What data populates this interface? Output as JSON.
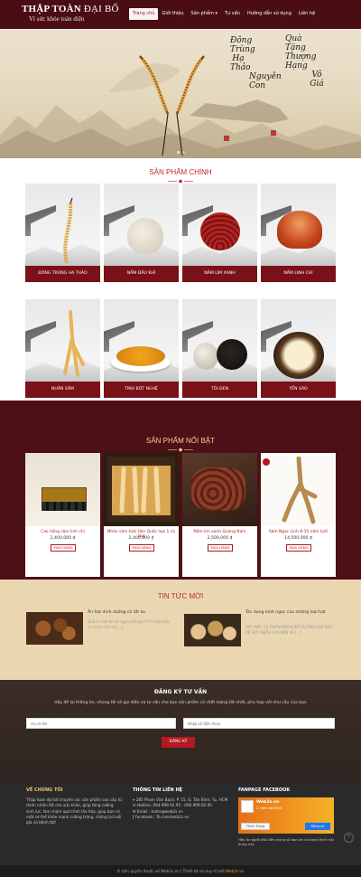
{
  "header": {
    "logo_main": "THẬP TOÀN",
    "logo_accent": " ĐẠI BỔ",
    "tagline": "Vì sức khỏe toàn diện",
    "nav": [
      "Trang chủ",
      "Giới thiệu",
      "Sản phẩm ▾",
      "Tư vấn",
      "Hướng dẫn sử dụng",
      "Liên hệ"
    ]
  },
  "banner": {
    "calligraphy": [
      "Đông",
      "Trùng",
      "Hạ",
      "Thảo",
      "Nguyên",
      "Con",
      "Quà",
      "Tặng",
      "Thượng",
      "Hạng",
      "Vô",
      "Giá"
    ]
  },
  "main_products": {
    "title": "SẢN PHẨM CHÍNH",
    "items": [
      "ĐÔNG TRÙNG HẠ THẢO",
      "NẤM ĐẦU KHỈ",
      "NẤM LIM XANH",
      "NẤM LINH CHI",
      "NHÂN SÂM",
      "TINH BỘT NGHỆ",
      "TỎI ĐEN",
      "YẾN SÀO"
    ]
  },
  "featured": {
    "title": "SẢN PHẨM NỔI BẬT",
    "items": [
      {
        "name": "Cao hồng sâm linh chi",
        "price": "2,400,000 ₫",
        "buy": "MUA HÀNG"
      },
      {
        "name": "Nhân sâm tươi Hàn Quốc loại 1 củ 1kg",
        "price": "2,400,000 ₫",
        "buy": "MUA HÀNG"
      },
      {
        "name": "Nấm lim xanh Quảng Nam",
        "price": "2,500,000 ₫",
        "buy": "MUA HÀNG"
      },
      {
        "name": "Sâm Ngọc Linh 8-10 năm tuổi",
        "price": "14,500,000 ₫",
        "buy": "MUA HÀNG"
      }
    ]
  },
  "news": {
    "title": "TIN TỨC MỚI",
    "items": [
      {
        "title": "Ăn hạt dinh dưỡng có tốt ko",
        "excerpt": "Quả óc chó ăn có ngon không ai???? Hạt mắc ca và óc chó có [...]"
      },
      {
        "title": "Tác dụng kinh ngạc của những loại hạt",
        "excerpt": "HẠT MẮC CA THƠM NGON BỔ DƯỠNG HẠT BẢO VỆ SỨC KHỎE CỦA BẠN VÀ [...]"
      }
    ]
  },
  "register": {
    "title": "ĐĂNG KÝ TƯ VẤN",
    "desc": "Hãy để lại thông tin, chúng tôi sẽ gọi điện và tư vấn cho bạn sản phẩm có chất lượng tốt nhất, phù hợp với nhu cầu của bạn",
    "name_placeholder": "Họ và tên",
    "phone_placeholder": "Nhập số điện thoại",
    "submit": "ĐĂNG KÝ"
  },
  "footer": {
    "about_title": "VỀ CHÚNG TÔI",
    "about_text": "Thập toàn đại bổ chuyên các sản phẩm cao cấp từ thiên nhiên tốt cho sức khỏe, giúp tăng cường sinh lực, làm chậm quá trình lão hóa, giúp bạn có một cơ thể khỏe mạnh cường tráng, chống lại tuổi già và bệnh tật!",
    "contact_title": "THÔNG TIN LIÊN HỆ",
    "contact": [
      "285 Phạm Văn Bạch, P. 15, Q. Tân Bình, Tp. HCM",
      "Hotline: 094.999.92.95 - 096.999.92.95",
      "Email : hotro@web2s.vn",
      "Facebook : fb.com/web2s.vn"
    ],
    "fanpage_title": "FANPAGE FACEBOOK",
    "fb_page_name": "Web2s.vn",
    "fb_likes": "2,766 lượt thích",
    "fb_like_button": "Thích Trang",
    "fb_cta": "Đăng ký",
    "fb_caption": "Hãy là người đầu tiên trong số bạn bè của bạn thích nội dung này",
    "copyright_prefix": "© bản quyền thuộc về Web2s.vn | Thiết kế và duy trì bởi ",
    "copyright_link": "Web2s.vn"
  },
  "colors": {
    "brand": "#4a0d14",
    "accent": "#c0272d",
    "news_bg": "#ead7b1"
  }
}
